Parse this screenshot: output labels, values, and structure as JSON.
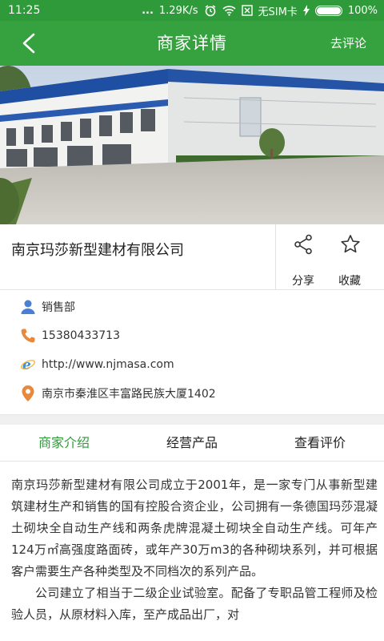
{
  "status_bar": {
    "time": "11:25",
    "dots": "...",
    "speed": "1.29K/s",
    "carrier": "无SIM卡",
    "battery_text": "100%",
    "battery_level": 1.0
  },
  "nav": {
    "title": "商家详情",
    "action_label": "去评论"
  },
  "company": {
    "name": "南京玛莎新型建材有限公司",
    "share_label": "分享",
    "favorite_label": "收藏"
  },
  "info": {
    "department": "销售部",
    "phone": "15380433713",
    "website": "http://www.njmasa.com",
    "address": "南京市秦淮区丰富路民族大厦1402"
  },
  "tabs": [
    {
      "label": "商家介绍",
      "active": true
    },
    {
      "label": "经营产品",
      "active": false
    },
    {
      "label": "查看评价",
      "active": false
    }
  ],
  "intro": {
    "paragraph1": "南京玛莎新型建材有限公司成立于2001年，是一家专门从事新型建筑建材生产和销售的国有控股合资企业，公司拥有一条德国玛莎混凝土砌块全自动生产线和两条虎牌混凝土砌块全自动生产线。可年产124万㎡高强度路面砖，或年产30万m3的各种砌块系列，并可根据客户需要生产各种类型及不同档次的系列产品。",
    "paragraph2": "公司建立了相当于二级企业试验室。配备了专职品管工程师及检验人员，从原材料入库，至产成品出厂，对"
  },
  "colors": {
    "brand_green": "#35a23f",
    "status_green": "#2f9a3a",
    "icon_blue": "#4a7fd6",
    "icon_orange": "#e9873a"
  }
}
